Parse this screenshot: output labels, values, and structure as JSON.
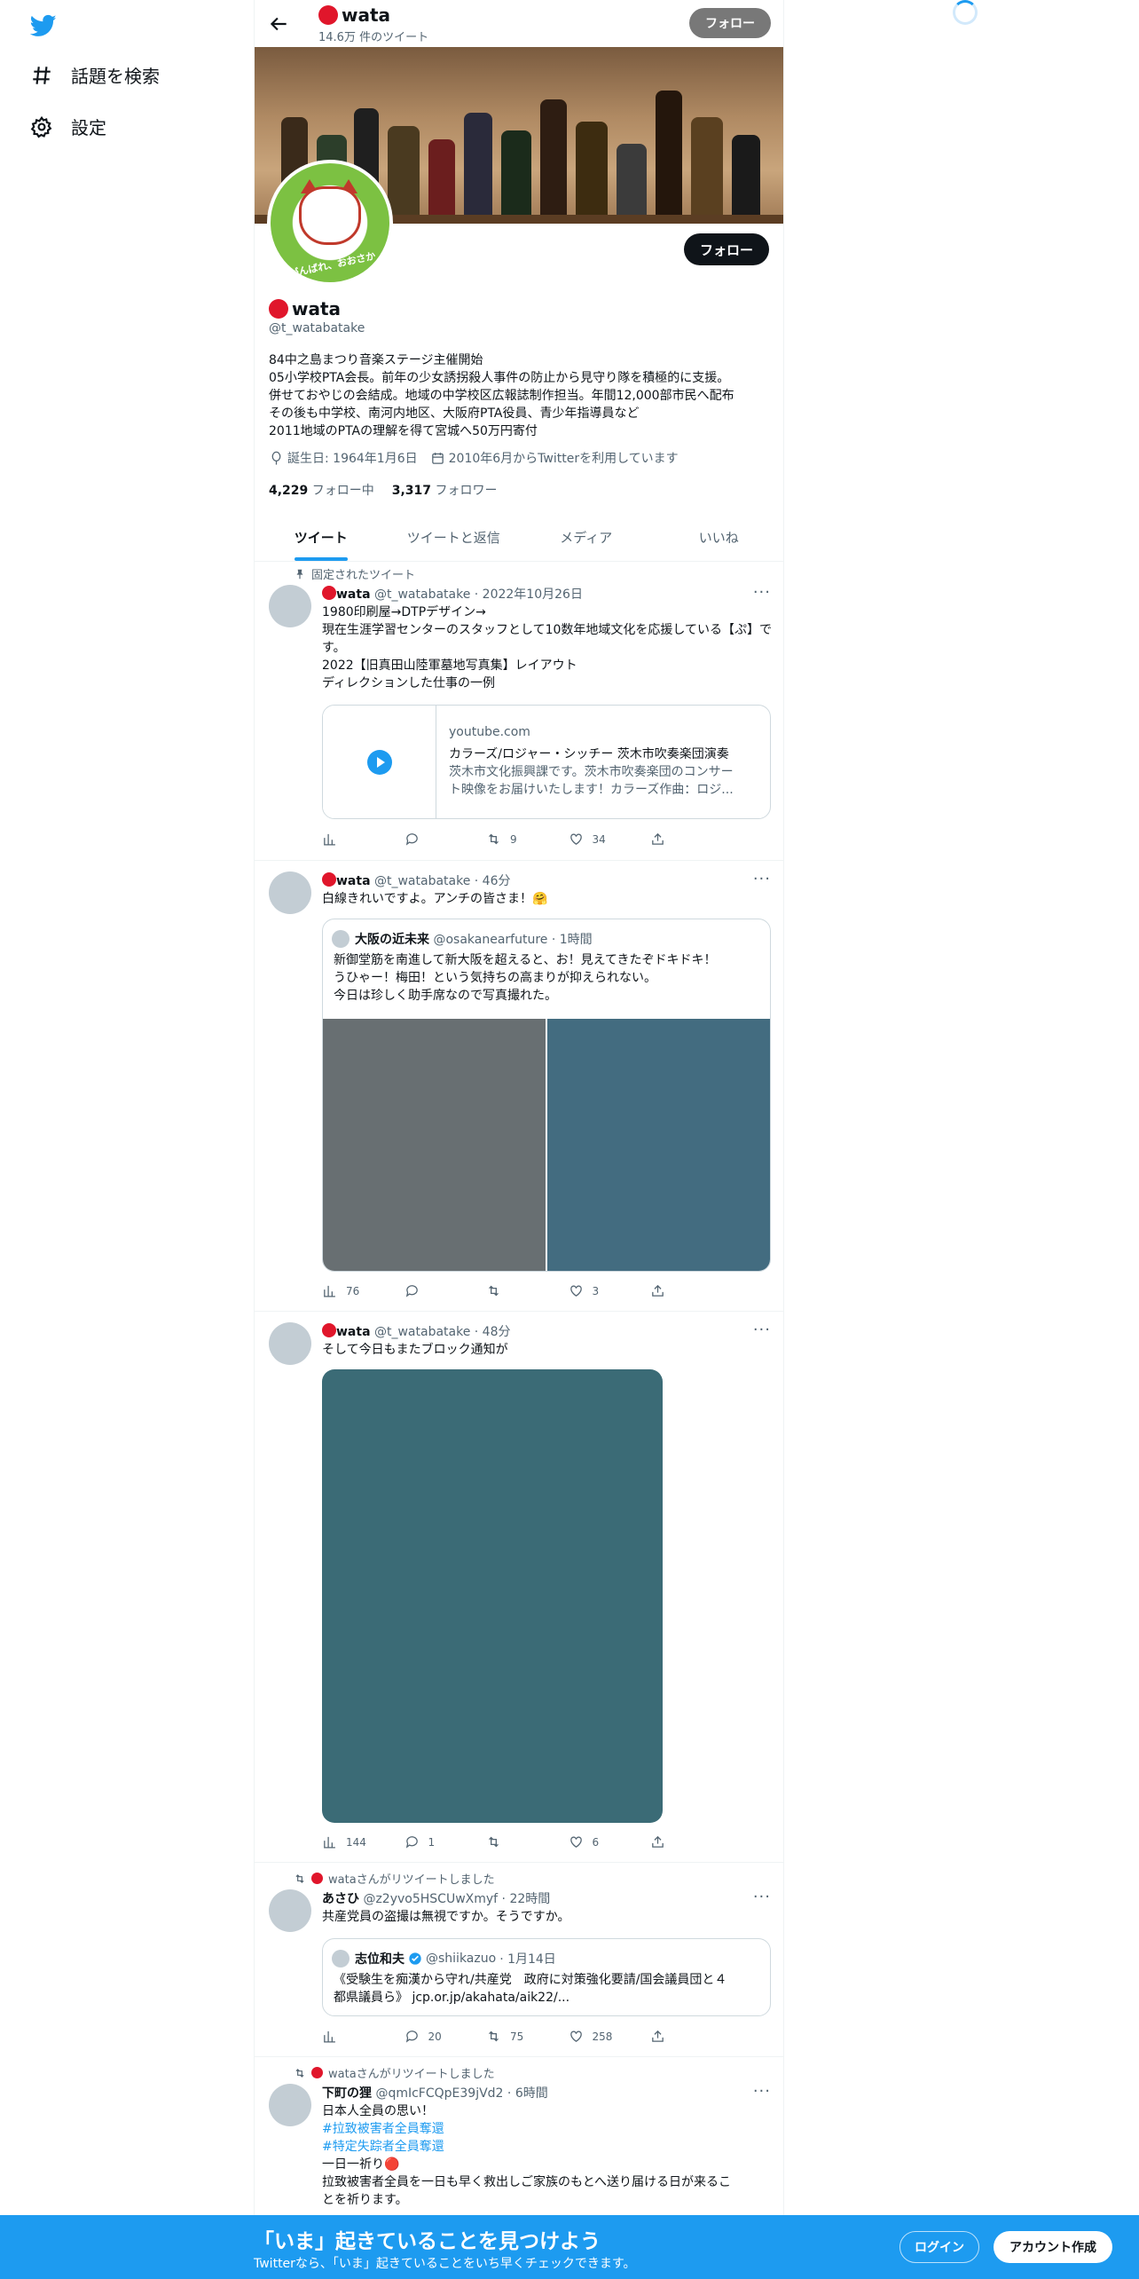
{
  "sidebar": {
    "items": [
      {
        "label": "話題を検索",
        "icon": "hashtag-icon"
      },
      {
        "label": "設定",
        "icon": "gear-icon"
      }
    ]
  },
  "topbar": {
    "name": "wata",
    "tweet_count": "14.6万 件のツイート",
    "follow_label": "フォロー"
  },
  "profile": {
    "name": "wata",
    "handle": "@t_watabatake",
    "follow_label": "フォロー",
    "avatar_text": "がんばれ、おおさか",
    "bio": [
      "84中之島まつり音楽ステージ主催開始",
      "05小学校PTA会長。前年の少女誘拐殺人事件の防止から見守り隊を積極的に支援。",
      "併せておやじの会結成。地域の中学校区広報誌制作担当。年間12,000部市民へ配布",
      "その後も中学校、南河内地区、大阪府PTA役員、青少年指導員など",
      "2011地域のPTAの理解を得て宮城へ50万円寄付"
    ],
    "birthday": "誕生日: 1964年1月6日",
    "joined": "2010年6月からTwitterを利用しています",
    "following_count": "4,229",
    "following_label": "フォロー中",
    "followers_count": "3,317",
    "followers_label": "フォロワー"
  },
  "tabs": [
    "ツイート",
    "ツイートと返信",
    "メディア",
    "いいね"
  ],
  "tweets": [
    {
      "context": "固定されたツイート",
      "name": "wata",
      "handle": "@t_watabatake",
      "time": "· 2022年10月26日",
      "text": [
        "1980印刷屋→DTPデザイン→",
        "現在生涯学習センターのスタッフとして10数年地域文化を応援している【ぷ】です。",
        "2022【旧真田山陸軍墓地写真集】レイアウト",
        "ディレクションした仕事の一例"
      ],
      "card": {
        "domain": "youtube.com",
        "title": "カラーズ/ロジャー・シッチー 茨木市吹奏楽団演奏",
        "desc1": "茨木市文化振興課です。茨木市吹奏楽団のコンサー",
        "desc2": "ト映像をお届けいたします！カラーズ作曲：ロジ..."
      },
      "views": "",
      "replies": "",
      "retweets": "9",
      "likes": "34"
    },
    {
      "name": "wata",
      "handle": "@t_watabatake",
      "time": "· 46分",
      "text": [
        "白線きれいですよ。アンチの皆さま！🤗"
      ],
      "quote": {
        "name": "大阪の近未来",
        "handle": "@osakanearfuture",
        "time": "· 1時間",
        "text": [
          "新御堂筋を南進して新大阪を超えると、お！見えてきたぞドキドキ！",
          "うひゃー！梅田！という気持ちの高まりが抑えられない。",
          "今日は珍しく助手席なので写真撮れた。"
        ]
      },
      "views": "76",
      "replies": "",
      "retweets": "",
      "likes": "3"
    },
    {
      "name": "wata",
      "handle": "@t_watabatake",
      "time": "· 48分",
      "text": [
        "そして今日もまたブロック通知が"
      ],
      "views": "144",
      "replies": "1",
      "retweets": "",
      "likes": "6"
    },
    {
      "context": "wataさんがリツイートしました",
      "name": "あさひ",
      "handle": "@z2yvo5HSCUwXmyf",
      "time": "· 22時間",
      "text": [
        "共産党員の盗撮は無視ですか。そうですか。"
      ],
      "quote": {
        "name": "志位和夫",
        "handle": "@shiikazuo",
        "time": "· 1月14日",
        "text": [
          "《受験生を痴漢から守れ/共産党　政府に対策強化要請/国会議員団と４",
          "都県議員ら》 jcp.or.jp/akahata/aik22/..."
        ]
      },
      "views": "",
      "replies": "20",
      "retweets": "75",
      "likes": "258"
    },
    {
      "context": "wataさんがリツイートしました",
      "name": "下町の狸",
      "handle": "@qmIcFCQpE39jVd2",
      "time": "· 6時間",
      "text": [
        "日本人全員の思い！",
        "#拉致被害者全員奪還",
        "#特定失踪者全員奪還",
        "一日一祈り🔴",
        "拉致被害者全員を一日も早く救出しご家族のもとへ送り届ける日が来るこ",
        "とを祈ります。"
      ]
    }
  ],
  "bottom_bar": {
    "title": "「いま」起きていることを見つけよう",
    "subtitle": "Twitterなら、「いま」起きていることをいち早くチェックできます。",
    "login": "ログイン",
    "signup": "アカウント作成"
  },
  "colors": {
    "accent": "#1d9bf0",
    "dot": "#e0162b",
    "text": "#0f1419",
    "muted": "#536471"
  }
}
